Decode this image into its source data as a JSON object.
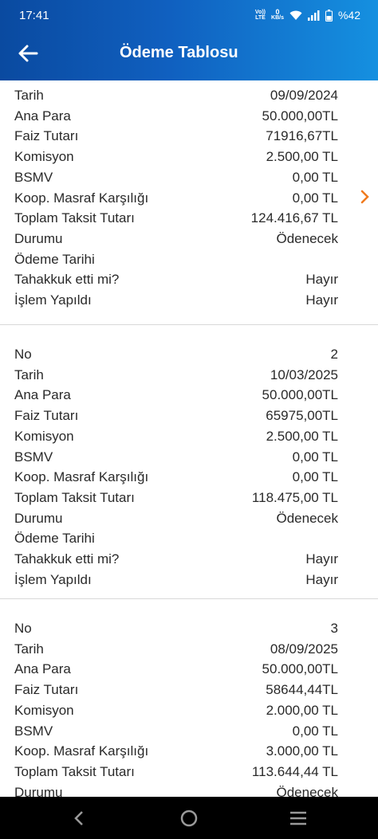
{
  "status": {
    "time": "17:41",
    "volte": "Vo))",
    "lte": "LTE",
    "net_speed": "0",
    "net_unit": "KB/s",
    "battery": "%42"
  },
  "header": {
    "title": "Ödeme Tablosu"
  },
  "cards": [
    {
      "rows": [
        {
          "label": "Tarih",
          "value": "09/09/2024"
        },
        {
          "label": "Ana Para",
          "value": "50.000,00TL"
        },
        {
          "label": "Faiz Tutarı",
          "value": "71916,67TL"
        },
        {
          "label": "Komisyon",
          "value": "2.500,00 TL"
        },
        {
          "label": "BSMV",
          "value": "0,00 TL"
        },
        {
          "label": "Koop. Masraf Karşılığı",
          "value": "0,00 TL"
        },
        {
          "label": "Toplam Taksit Tutarı",
          "value": "124.416,67 TL"
        },
        {
          "label": "Durumu",
          "value": "Ödenecek"
        },
        {
          "label": "Ödeme Tarihi",
          "value": ""
        },
        {
          "label": "Tahakkuk etti mi?",
          "value": "Hayır"
        },
        {
          "label": "İşlem Yapıldı",
          "value": "Hayır"
        }
      ]
    },
    {
      "rows": [
        {
          "label": "No",
          "value": "2"
        },
        {
          "label": "Tarih",
          "value": "10/03/2025"
        },
        {
          "label": "Ana Para",
          "value": "50.000,00TL"
        },
        {
          "label": "Faiz Tutarı",
          "value": "65975,00TL"
        },
        {
          "label": "Komisyon",
          "value": "2.500,00 TL"
        },
        {
          "label": "BSMV",
          "value": "0,00 TL"
        },
        {
          "label": "Koop. Masraf Karşılığı",
          "value": "0,00 TL"
        },
        {
          "label": "Toplam Taksit Tutarı",
          "value": "118.475,00 TL"
        },
        {
          "label": "Durumu",
          "value": "Ödenecek"
        },
        {
          "label": "Ödeme Tarihi",
          "value": ""
        },
        {
          "label": "Tahakkuk etti mi?",
          "value": "Hayır"
        },
        {
          "label": "İşlem Yapıldı",
          "value": "Hayır"
        }
      ]
    },
    {
      "rows": [
        {
          "label": "No",
          "value": "3"
        },
        {
          "label": "Tarih",
          "value": "08/09/2025"
        },
        {
          "label": "Ana Para",
          "value": "50.000,00TL"
        },
        {
          "label": "Faiz Tutarı",
          "value": "58644,44TL"
        },
        {
          "label": "Komisyon",
          "value": "2.000,00 TL"
        },
        {
          "label": "BSMV",
          "value": "0,00 TL"
        },
        {
          "label": "Koop. Masraf Karşılığı",
          "value": "3.000,00 TL"
        },
        {
          "label": "Toplam Taksit Tutarı",
          "value": "113.644,44 TL"
        },
        {
          "label": "Durumu",
          "value": "Ödenecek"
        }
      ]
    }
  ],
  "icons": {
    "back": "arrow-left-icon",
    "next": "chevron-right-icon",
    "nav_back": "nav-back-icon",
    "nav_home": "nav-home-icon",
    "nav_recents": "nav-recents-icon"
  },
  "colors": {
    "header_start": "#0a4aa0",
    "header_end": "#1590e0",
    "chevron": "#f07a1e"
  }
}
